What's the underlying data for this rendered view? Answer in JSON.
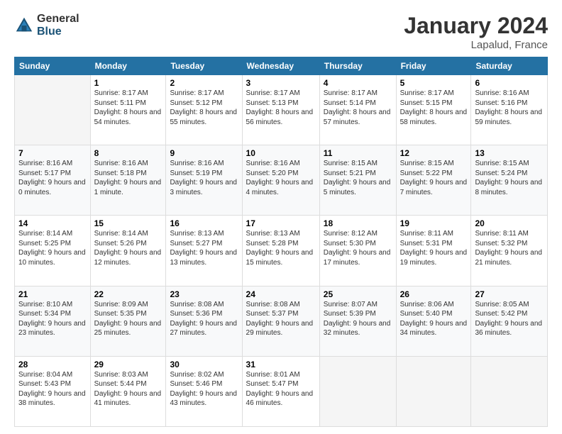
{
  "logo": {
    "general": "General",
    "blue": "Blue"
  },
  "header": {
    "month": "January 2024",
    "location": "Lapalud, France"
  },
  "days_of_week": [
    "Sunday",
    "Monday",
    "Tuesday",
    "Wednesday",
    "Thursday",
    "Friday",
    "Saturday"
  ],
  "weeks": [
    [
      {
        "day": "",
        "sunrise": "",
        "sunset": "",
        "daylight": ""
      },
      {
        "day": "1",
        "sunrise": "Sunrise: 8:17 AM",
        "sunset": "Sunset: 5:11 PM",
        "daylight": "Daylight: 8 hours and 54 minutes."
      },
      {
        "day": "2",
        "sunrise": "Sunrise: 8:17 AM",
        "sunset": "Sunset: 5:12 PM",
        "daylight": "Daylight: 8 hours and 55 minutes."
      },
      {
        "day": "3",
        "sunrise": "Sunrise: 8:17 AM",
        "sunset": "Sunset: 5:13 PM",
        "daylight": "Daylight: 8 hours and 56 minutes."
      },
      {
        "day": "4",
        "sunrise": "Sunrise: 8:17 AM",
        "sunset": "Sunset: 5:14 PM",
        "daylight": "Daylight: 8 hours and 57 minutes."
      },
      {
        "day": "5",
        "sunrise": "Sunrise: 8:17 AM",
        "sunset": "Sunset: 5:15 PM",
        "daylight": "Daylight: 8 hours and 58 minutes."
      },
      {
        "day": "6",
        "sunrise": "Sunrise: 8:16 AM",
        "sunset": "Sunset: 5:16 PM",
        "daylight": "Daylight: 8 hours and 59 minutes."
      }
    ],
    [
      {
        "day": "7",
        "sunrise": "Sunrise: 8:16 AM",
        "sunset": "Sunset: 5:17 PM",
        "daylight": "Daylight: 9 hours and 0 minutes."
      },
      {
        "day": "8",
        "sunrise": "Sunrise: 8:16 AM",
        "sunset": "Sunset: 5:18 PM",
        "daylight": "Daylight: 9 hours and 1 minute."
      },
      {
        "day": "9",
        "sunrise": "Sunrise: 8:16 AM",
        "sunset": "Sunset: 5:19 PM",
        "daylight": "Daylight: 9 hours and 3 minutes."
      },
      {
        "day": "10",
        "sunrise": "Sunrise: 8:16 AM",
        "sunset": "Sunset: 5:20 PM",
        "daylight": "Daylight: 9 hours and 4 minutes."
      },
      {
        "day": "11",
        "sunrise": "Sunrise: 8:15 AM",
        "sunset": "Sunset: 5:21 PM",
        "daylight": "Daylight: 9 hours and 5 minutes."
      },
      {
        "day": "12",
        "sunrise": "Sunrise: 8:15 AM",
        "sunset": "Sunset: 5:22 PM",
        "daylight": "Daylight: 9 hours and 7 minutes."
      },
      {
        "day": "13",
        "sunrise": "Sunrise: 8:15 AM",
        "sunset": "Sunset: 5:24 PM",
        "daylight": "Daylight: 9 hours and 8 minutes."
      }
    ],
    [
      {
        "day": "14",
        "sunrise": "Sunrise: 8:14 AM",
        "sunset": "Sunset: 5:25 PM",
        "daylight": "Daylight: 9 hours and 10 minutes."
      },
      {
        "day": "15",
        "sunrise": "Sunrise: 8:14 AM",
        "sunset": "Sunset: 5:26 PM",
        "daylight": "Daylight: 9 hours and 12 minutes."
      },
      {
        "day": "16",
        "sunrise": "Sunrise: 8:13 AM",
        "sunset": "Sunset: 5:27 PM",
        "daylight": "Daylight: 9 hours and 13 minutes."
      },
      {
        "day": "17",
        "sunrise": "Sunrise: 8:13 AM",
        "sunset": "Sunset: 5:28 PM",
        "daylight": "Daylight: 9 hours and 15 minutes."
      },
      {
        "day": "18",
        "sunrise": "Sunrise: 8:12 AM",
        "sunset": "Sunset: 5:30 PM",
        "daylight": "Daylight: 9 hours and 17 minutes."
      },
      {
        "day": "19",
        "sunrise": "Sunrise: 8:11 AM",
        "sunset": "Sunset: 5:31 PM",
        "daylight": "Daylight: 9 hours and 19 minutes."
      },
      {
        "day": "20",
        "sunrise": "Sunrise: 8:11 AM",
        "sunset": "Sunset: 5:32 PM",
        "daylight": "Daylight: 9 hours and 21 minutes."
      }
    ],
    [
      {
        "day": "21",
        "sunrise": "Sunrise: 8:10 AM",
        "sunset": "Sunset: 5:34 PM",
        "daylight": "Daylight: 9 hours and 23 minutes."
      },
      {
        "day": "22",
        "sunrise": "Sunrise: 8:09 AM",
        "sunset": "Sunset: 5:35 PM",
        "daylight": "Daylight: 9 hours and 25 minutes."
      },
      {
        "day": "23",
        "sunrise": "Sunrise: 8:08 AM",
        "sunset": "Sunset: 5:36 PM",
        "daylight": "Daylight: 9 hours and 27 minutes."
      },
      {
        "day": "24",
        "sunrise": "Sunrise: 8:08 AM",
        "sunset": "Sunset: 5:37 PM",
        "daylight": "Daylight: 9 hours and 29 minutes."
      },
      {
        "day": "25",
        "sunrise": "Sunrise: 8:07 AM",
        "sunset": "Sunset: 5:39 PM",
        "daylight": "Daylight: 9 hours and 32 minutes."
      },
      {
        "day": "26",
        "sunrise": "Sunrise: 8:06 AM",
        "sunset": "Sunset: 5:40 PM",
        "daylight": "Daylight: 9 hours and 34 minutes."
      },
      {
        "day": "27",
        "sunrise": "Sunrise: 8:05 AM",
        "sunset": "Sunset: 5:42 PM",
        "daylight": "Daylight: 9 hours and 36 minutes."
      }
    ],
    [
      {
        "day": "28",
        "sunrise": "Sunrise: 8:04 AM",
        "sunset": "Sunset: 5:43 PM",
        "daylight": "Daylight: 9 hours and 38 minutes."
      },
      {
        "day": "29",
        "sunrise": "Sunrise: 8:03 AM",
        "sunset": "Sunset: 5:44 PM",
        "daylight": "Daylight: 9 hours and 41 minutes."
      },
      {
        "day": "30",
        "sunrise": "Sunrise: 8:02 AM",
        "sunset": "Sunset: 5:46 PM",
        "daylight": "Daylight: 9 hours and 43 minutes."
      },
      {
        "day": "31",
        "sunrise": "Sunrise: 8:01 AM",
        "sunset": "Sunset: 5:47 PM",
        "daylight": "Daylight: 9 hours and 46 minutes."
      },
      {
        "day": "",
        "sunrise": "",
        "sunset": "",
        "daylight": ""
      },
      {
        "day": "",
        "sunrise": "",
        "sunset": "",
        "daylight": ""
      },
      {
        "day": "",
        "sunrise": "",
        "sunset": "",
        "daylight": ""
      }
    ]
  ]
}
